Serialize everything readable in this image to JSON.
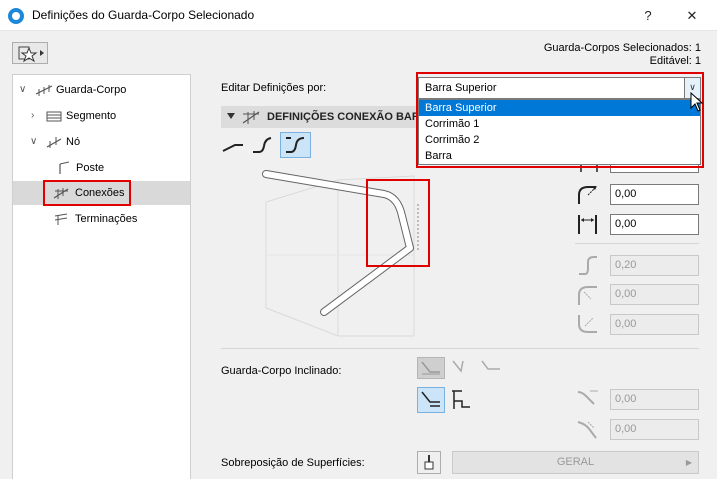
{
  "window": {
    "title": "Definições do Guarda-Corpo Selecionado",
    "help_label": "?",
    "close_label": "✕"
  },
  "status": {
    "selected": "Guarda-Corpos Selecionados: 1",
    "editable": "Editável: 1"
  },
  "tree": {
    "items": [
      {
        "label": "Guarda-Corpo",
        "icon": "railing-icon"
      },
      {
        "label": "Segmento",
        "icon": "segment-icon"
      },
      {
        "label": "Nó",
        "icon": "node-icon"
      },
      {
        "label": "Poste",
        "icon": "post-icon"
      },
      {
        "label": "Conexões",
        "icon": "connections-icon"
      },
      {
        "label": "Terminações",
        "icon": "endings-icon"
      }
    ]
  },
  "edit_by": {
    "label": "Editar Definições por:",
    "value": "Barra Superior",
    "options": [
      "Barra Superior",
      "Corrimão 1",
      "Corrimão 2",
      "Barra"
    ]
  },
  "section": {
    "title": "DEFINIÇÕES CONEXÃO BARRA"
  },
  "fields": {
    "f1": "0,00",
    "f2": "0,00",
    "f3": "0,00",
    "d1": "0,20",
    "d2": "0,00",
    "d3": "0,00",
    "inc1": "0,00",
    "inc2": "0,00"
  },
  "inclined": {
    "label": "Guarda-Corpo Inclinado:"
  },
  "overlap": {
    "label": "Sobreposição de Superfícies:",
    "button": "GERAL"
  },
  "colors": {
    "accent": "#0078d7",
    "highlight": "#e00000"
  }
}
